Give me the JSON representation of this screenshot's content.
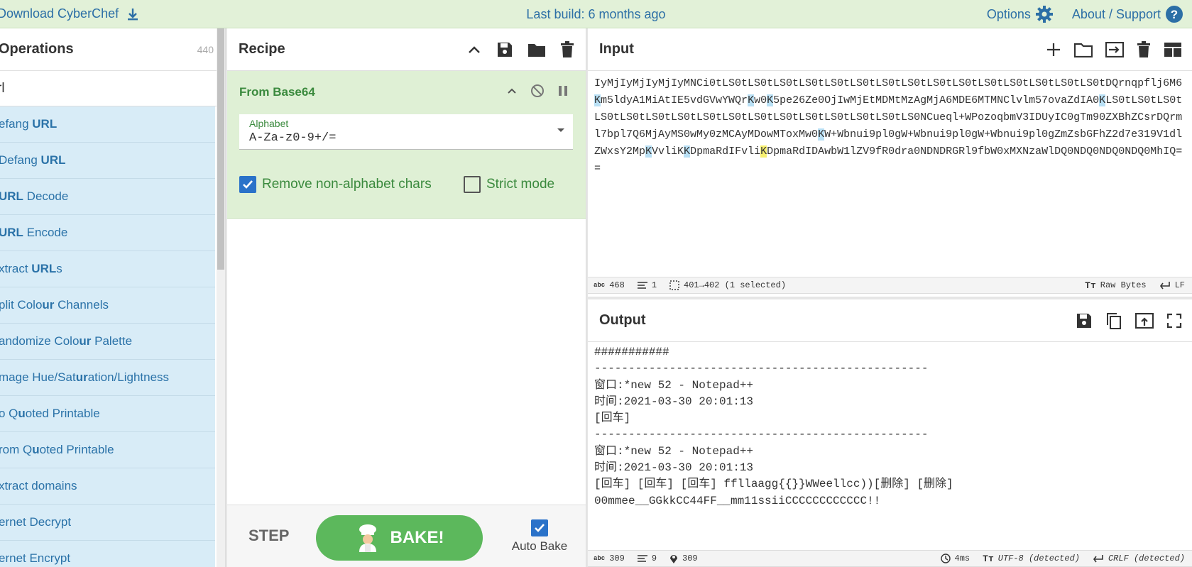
{
  "topbar": {
    "download": "Download CyberChef",
    "build": "Last build: 6 months ago",
    "options": "Options",
    "about": "About / Support"
  },
  "operations": {
    "title": "Operations",
    "count": "440",
    "search_value": "rl",
    "items": [
      {
        "pre": "efang ",
        "b": "URL",
        "post": ""
      },
      {
        "pre": "Defang ",
        "b": "URL",
        "post": ""
      },
      {
        "pre": "",
        "b": "URL",
        "post": " Decode"
      },
      {
        "pre": "",
        "b": "URL",
        "post": " Encode"
      },
      {
        "pre": "xtract ",
        "b": "URL",
        "post": "s"
      },
      {
        "pre": "plit Colo",
        "b": "ur",
        "post": " Channels"
      },
      {
        "pre": "andomize Colo",
        "b": "ur",
        "post": " Palette"
      },
      {
        "pre": "mage Hue/Sat",
        "b": "ur",
        "post": "ation/Lightness"
      },
      {
        "pre": "o Q",
        "b": "u",
        "post": "oted Printable"
      },
      {
        "pre": "rom Q",
        "b": "u",
        "post": "oted Printable"
      },
      {
        "pre": "xtract domains",
        "b": "",
        "post": ""
      },
      {
        "pre": "ernet Decrypt",
        "b": "",
        "post": ""
      },
      {
        "pre": "ernet Encrypt",
        "b": "",
        "post": ""
      }
    ]
  },
  "recipe": {
    "title": "Recipe",
    "ingredient": {
      "name": "From Base64",
      "alphabet_label": "Alphabet",
      "alphabet_value": "A-Za-z0-9+/=",
      "remove_label": "Remove non-alphabet chars",
      "strict_label": "Strict mode"
    },
    "step_label": "STEP",
    "bake_label": "BAKE!",
    "autobake_label": "Auto Bake"
  },
  "input": {
    "title": "Input",
    "text_parts": [
      {
        "t": "IyMjIyMjIyMjIyMNCi0tLS0tLS0tLS0tLS0tLS0tLS0tLS0tLS0tLS0tLS0tLS0tLS0tLS0tLS0tLS0tDQrnqpflj6M6",
        "h": ""
      },
      {
        "t": "K",
        "h": "b"
      },
      {
        "t": "m5ldyA1MiAtIE5vdGVwYWQr",
        "h": ""
      },
      {
        "t": "K",
        "h": "b"
      },
      {
        "t": "w0",
        "h": ""
      },
      {
        "t": "K",
        "h": "b"
      },
      {
        "t": "5pe26Ze0OjIwMjEtMDMtMzAgMjA6MDE6MTMNClvlm57ovaZdIA0",
        "h": ""
      },
      {
        "t": "K",
        "h": "b"
      },
      {
        "t": "LS0tLS0tLS0tLS0tLS0tLS0tLS0tLS0tLS0tLS0tLS0tLS0tLS0tLS0tLS0tLS0NCueql+WPozoqbmV3IDUyIC0gTm90ZXBhZCsrDQrml7bpl7Q6MjAyMS0wMy0zMCAyMDowMToxMw0",
        "h": ""
      },
      {
        "t": "K",
        "h": "b"
      },
      {
        "t": "W+Wbnui9pl0gW+Wbnui9pl0gW+Wbnui9pl0gZmZsbGFhZ2d7e319V1dlZWxsY2Mp",
        "h": ""
      },
      {
        "t": "K",
        "h": "b"
      },
      {
        "t": "VvliK",
        "h": ""
      },
      {
        "t": "K",
        "h": "b"
      },
      {
        "t": "DpmaRdIFvli",
        "h": ""
      },
      {
        "t": "K",
        "h": "y"
      },
      {
        "t": "DpmaRdIDAwbW1lZV9fR0dra0NDNDRGRl9fbW0xMXNzaWlDQ0NDQ0NDQ0NDQ0MhIQ==",
        "h": ""
      }
    ],
    "status": {
      "chars": "468",
      "lines": "1",
      "selection": "401→402 (1 selected)",
      "encoding": "Raw Bytes",
      "eol": "LF"
    }
  },
  "output": {
    "title": "Output",
    "text": "###########\n-------------------------------------------------\n窗口:*new 52 - Notepad++\n时间:2021-03-30 20:01:13\n[回车]\n-------------------------------------------------\n窗口:*new 52 - Notepad++\n时间:2021-03-30 20:01:13\n[回车] [回车] [回车] ffllaagg{{}}WWeellcc))[删除] [删除]\n00mmee__GGkkCC44FF__mm11ssiiCCCCCCCCCCCC!!",
    "status": {
      "chars": "309",
      "lines": "9",
      "position": "309",
      "time": "4ms",
      "encoding": "UTF-8 (detected)",
      "eol": "CRLF (detected)"
    }
  },
  "colors": {
    "topbar": "#e2f1d8",
    "op_item": "#d8ecf7",
    "ingredient": "#dff0d5",
    "bake": "#5cb85c",
    "link": "#2c6fa6"
  }
}
